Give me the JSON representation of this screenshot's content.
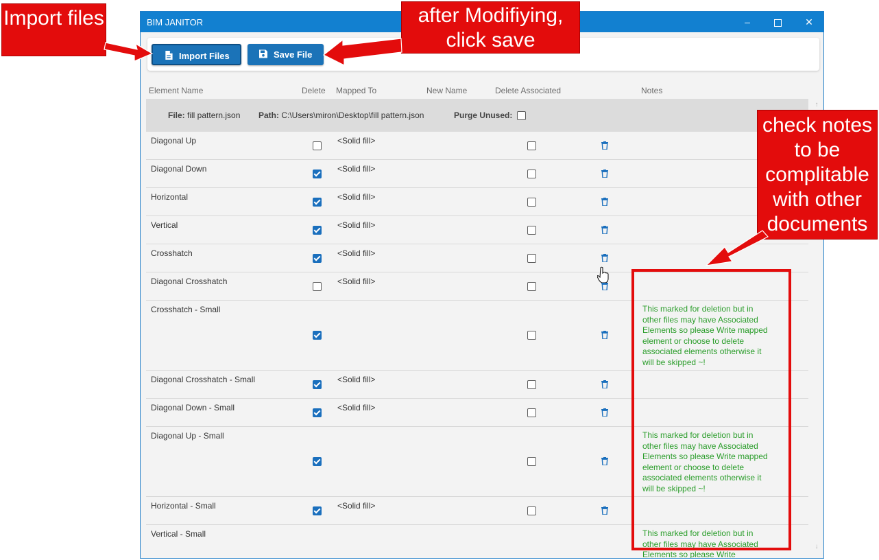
{
  "window": {
    "title": "BIM JANITOR",
    "minimize": "–",
    "close": "✕"
  },
  "toolbar": {
    "import_label": "Import Files",
    "save_label": "Save File"
  },
  "columns": {
    "element_name": "Element Name",
    "delete": "Delete",
    "mapped_to": "Mapped To",
    "new_name": "New Name",
    "delete_associated": "Delete Associated",
    "notes": "Notes"
  },
  "file": {
    "file_label": "File:",
    "file_name": "fill pattern.json",
    "path_label": "Path:",
    "path": "C:\\Users\\miron\\Desktop\\fill pattern.json",
    "purge_label": "Purge Unused:",
    "purge_checked": false
  },
  "rows": [
    {
      "name": "Diagonal Up",
      "delete": false,
      "mapped": "<Solid fill>",
      "delete_associated": false,
      "note": ""
    },
    {
      "name": "Diagonal Down",
      "delete": true,
      "mapped": "<Solid fill>",
      "delete_associated": false,
      "note": ""
    },
    {
      "name": "Horizontal",
      "delete": true,
      "mapped": "<Solid fill>",
      "delete_associated": false,
      "note": ""
    },
    {
      "name": "Vertical",
      "delete": true,
      "mapped": "<Solid fill>",
      "delete_associated": false,
      "note": ""
    },
    {
      "name": "Crosshatch",
      "delete": true,
      "mapped": "<Solid fill>",
      "delete_associated": false,
      "note": ""
    },
    {
      "name": "Diagonal Crosshatch",
      "delete": false,
      "mapped": "<Solid fill>",
      "delete_associated": false,
      "note": ""
    },
    {
      "name": "Crosshatch - Small",
      "delete": true,
      "mapped": "",
      "delete_associated": false,
      "note": "This marked for deletion but in other files may have Associated Elements so please Write mapped element or choose to delete associated elements otherwise it will be skipped ~!"
    },
    {
      "name": "Diagonal Crosshatch - Small",
      "delete": true,
      "mapped": "<Solid fill>",
      "delete_associated": false,
      "note": ""
    },
    {
      "name": "Diagonal Down - Small",
      "delete": true,
      "mapped": "<Solid fill>",
      "delete_associated": false,
      "note": ""
    },
    {
      "name": "Diagonal Up - Small",
      "delete": true,
      "mapped": "",
      "delete_associated": false,
      "note": "This marked for deletion but in other files may have Associated Elements so please Write mapped element or choose to delete associated elements otherwise it will be skipped ~!"
    },
    {
      "name": "Horizontal - Small",
      "delete": true,
      "mapped": "<Solid fill>",
      "delete_associated": false,
      "note": ""
    },
    {
      "name": "Vertical - Small",
      "delete": null,
      "mapped": "",
      "delete_associated": null,
      "note": "This marked for deletion but in other files may have Associated Elements so please Write"
    }
  ],
  "annotations": {
    "import": "Import files",
    "save": "after Modifiying, click save",
    "notes": "check notes to be complitable with other documents"
  },
  "colors": {
    "accent": "#1280d0",
    "button": "#1b73b8",
    "note_text": "#2a9d2a",
    "callout": "#e30c0c"
  }
}
